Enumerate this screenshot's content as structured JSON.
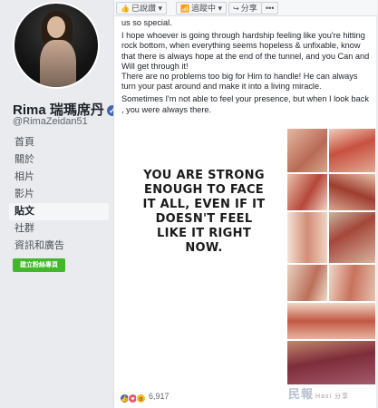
{
  "profile": {
    "name": "Rima 瑞瑪席丹",
    "handle": "@RimaZeidan51"
  },
  "nav": {
    "items": [
      "首頁",
      "關於",
      "相片",
      "影片",
      "貼文",
      "社群",
      "資訊和廣告"
    ],
    "active": "貼文",
    "create_page": "建立粉絲專頁"
  },
  "actions": {
    "liked": "已說讚",
    "following": "追蹤中",
    "share": "分享",
    "more": "•••"
  },
  "post": {
    "paragraphs": [
      "us so special.",
      "I hope whoever is going through hardship feeling like you're hitting rock bottom, when everything seems hopeless & unfixable, know that there is always hope at the end of the tunnel, and you Can and Will get through it!",
      "There are no problems too big for Him to handle! He can always turn your past around and make it into a living miracle.",
      "Sometimes I'm not able to feel your presence, but when I look back , you were always there."
    ],
    "image_quote": "YOU ARE STRONG ENOUGH TO FACE IT ALL, EVEN IF IT DOESN'T FEEL LIKE IT RIGHT NOW."
  },
  "reactions": {
    "count": "6,917",
    "types": [
      "like-icon",
      "love-icon",
      "wow-icon"
    ]
  },
  "watermark": {
    "text": "民報",
    "sub": "Hasi 分享"
  },
  "colors": {
    "brand": "#4267b2",
    "create_button": "#42b72a",
    "background": "#e9ebee"
  }
}
